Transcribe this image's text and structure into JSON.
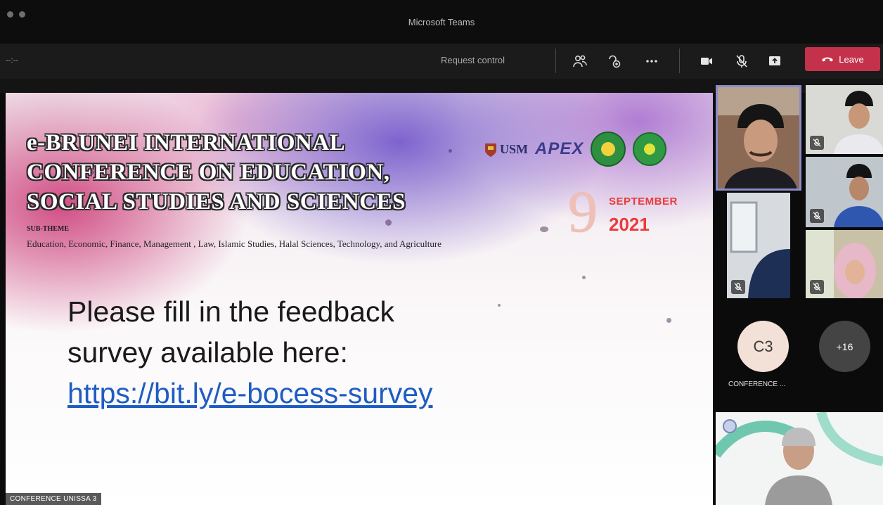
{
  "window": {
    "title": "Microsoft Teams"
  },
  "toolbar": {
    "timer": "--:--",
    "request_control": "Request control",
    "leave_label": "Leave",
    "icons": [
      "participants-icon",
      "share-tray-icon",
      "more-options-icon",
      "camera-icon",
      "mic-off-icon",
      "share-screen-icon",
      "hang-up-icon"
    ]
  },
  "slide": {
    "title_lines": [
      "e-BRUNEI INTERNATIONAL",
      "CONFERENCE ON EDUCATION,",
      "SOCIAL STUDIES AND SCIENCES"
    ],
    "subtheme_label": "SUB-THEME",
    "subtheme_text": "Education, Economic, Finance, Management , Law, Islamic Studies, Halal Sciences, Technology, and Agriculture",
    "logos": {
      "usm": "USM",
      "apex": "APEX"
    },
    "date": {
      "day": "9",
      "month": "SEPTEMBER",
      "year": "2021"
    },
    "feedback_line1": "Please fill in the feedback",
    "feedback_line2": "survey available here:",
    "link": "https://bit.ly/e-bocess-survey"
  },
  "presenter_label": "CONFERENCE UNISSA 3",
  "participants": {
    "avatar_initials": "C3",
    "avatar_name": "CONFERENCE ...",
    "more_count": "+16"
  },
  "colors": {
    "leave": "#c4314b",
    "active_border": "#8b8cc7",
    "link": "#1f5cc4",
    "date": "#e83b3b"
  }
}
